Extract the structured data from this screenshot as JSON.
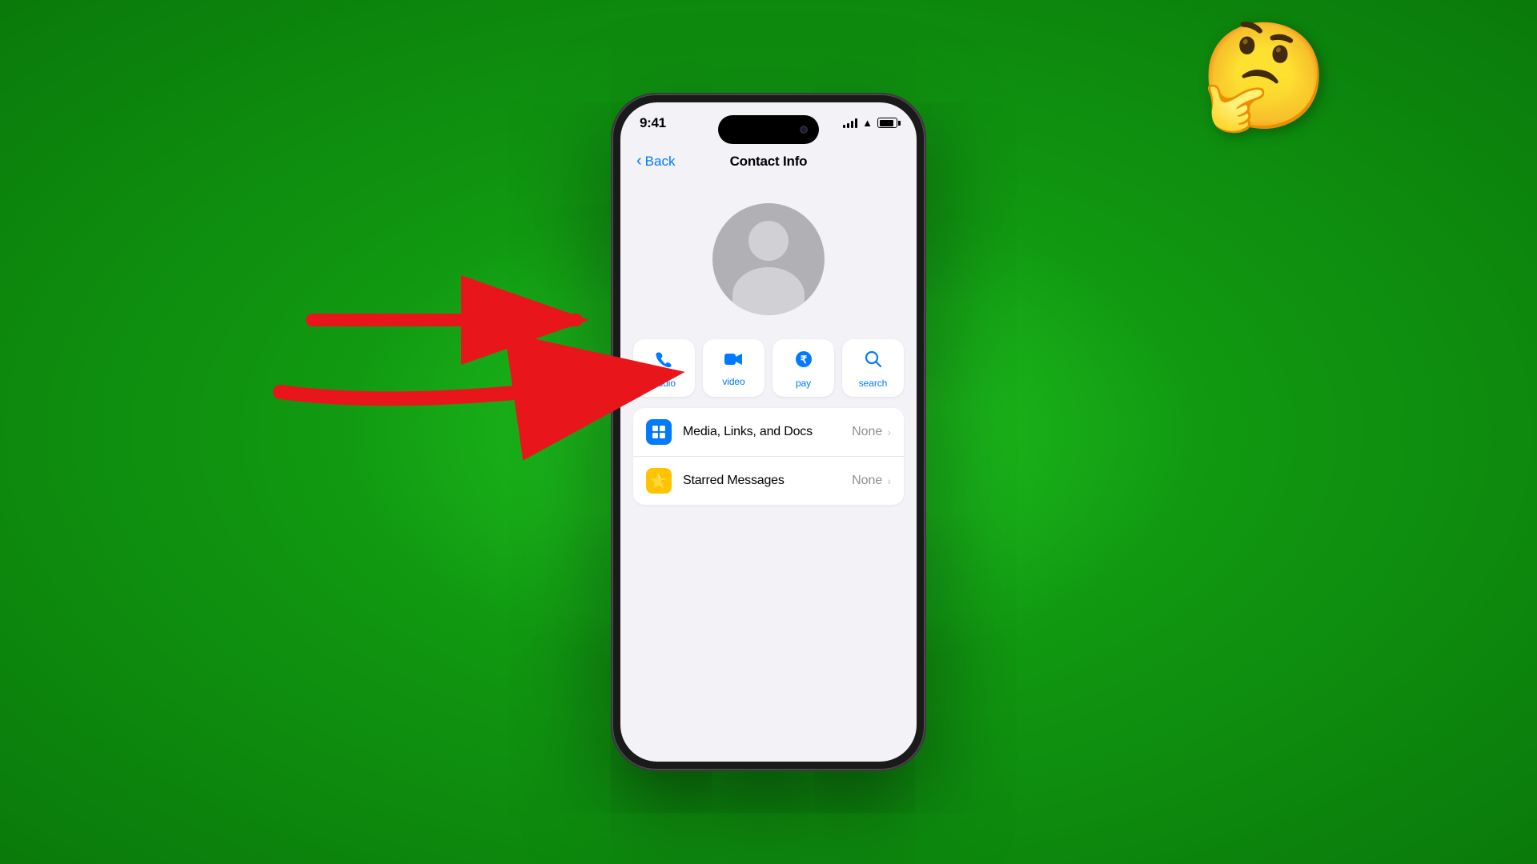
{
  "background": {
    "gradient_start": "#22cc22",
    "gradient_end": "#0a7a0a"
  },
  "phone": {
    "status_bar": {
      "time": "9:41"
    },
    "nav": {
      "back_label": "Back",
      "title": "Contact Info"
    },
    "avatar": {
      "placeholder": "contact avatar"
    },
    "action_buttons": [
      {
        "id": "audio",
        "label": "audio",
        "icon": "📞"
      },
      {
        "id": "video",
        "label": "video",
        "icon": "📹"
      },
      {
        "id": "pay",
        "label": "pay",
        "icon": "₹"
      },
      {
        "id": "search",
        "label": "search",
        "icon": "🔍"
      }
    ],
    "menu_items": [
      {
        "id": "media-links-docs",
        "icon_type": "blue",
        "icon": "🖼",
        "text": "Media, Links, and Docs",
        "value": "None"
      },
      {
        "id": "starred-messages",
        "icon_type": "yellow",
        "icon": "⭐",
        "text": "Starred Messages",
        "value": "None"
      }
    ]
  },
  "emoji": {
    "thinking": "🤔"
  },
  "arrow": {
    "color": "#e8161a",
    "description": "red arrow pointing to avatar"
  }
}
